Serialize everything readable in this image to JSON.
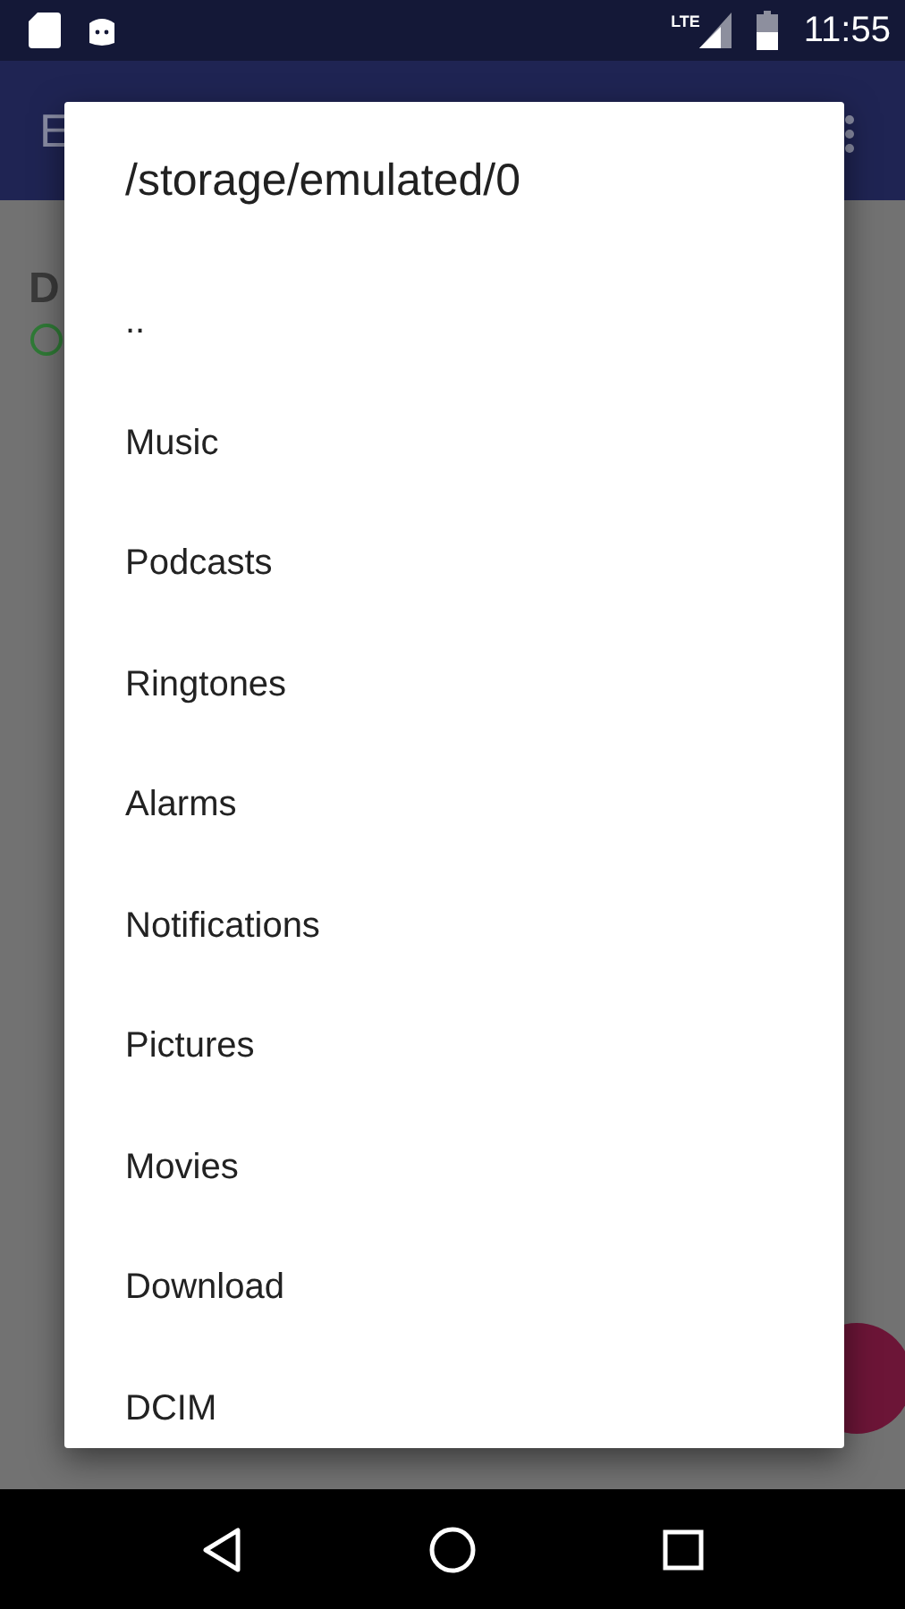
{
  "status_bar": {
    "network": "LTE",
    "time": "11:55"
  },
  "app_bar": {
    "title": "E"
  },
  "content": {
    "heading": "D"
  },
  "dialog": {
    "title": "/storage/emulated/0",
    "items": [
      {
        "label": ".."
      },
      {
        "label": "Music"
      },
      {
        "label": "Podcasts"
      },
      {
        "label": "Ringtones"
      },
      {
        "label": "Alarms"
      },
      {
        "label": "Notifications"
      },
      {
        "label": "Pictures"
      },
      {
        "label": "Movies"
      },
      {
        "label": "Download"
      },
      {
        "label": "DCIM"
      }
    ]
  }
}
